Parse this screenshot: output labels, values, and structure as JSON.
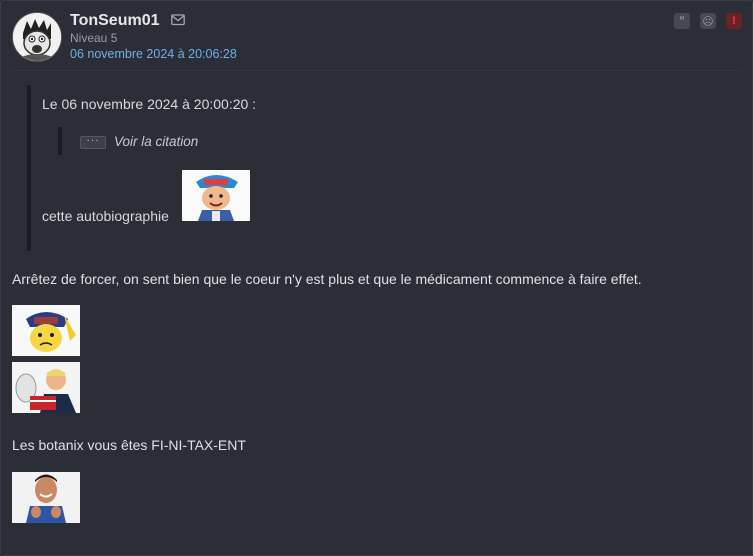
{
  "post": {
    "pseudo": "TonSeum01",
    "niveau": "Niveau 5",
    "date": "06 novembre 2024 à 20:06:28",
    "actions": [
      {
        "name": "quote-icon",
        "glyph": "”"
      },
      {
        "name": "ignore-icon",
        "glyph": "☹"
      },
      {
        "name": "report-icon",
        "glyph": "!"
      }
    ],
    "colors": {
      "background": "#2b2e36",
      "date": "#6fb0e6",
      "alert": "#e04a4f"
    }
  },
  "quote": {
    "header": "Le 06 novembre 2024 à 20:00:20 :",
    "nested_dots": "···",
    "nested_link": "Voir la citation",
    "text": "cette autobiographie"
  },
  "body": {
    "line1": "Arrêtez de forcer, on sent bien que le coeur n'y est plus et que le médicament commence à faire effet.",
    "line2": "Les botanix vous êtes FI-NI-TAX-ENT"
  }
}
